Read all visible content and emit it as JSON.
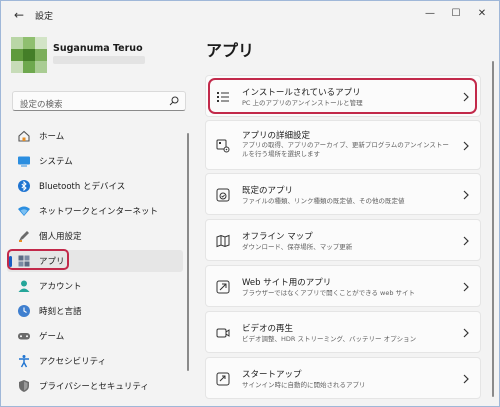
{
  "window": {
    "title": "設定",
    "back_icon": "back-arrow-icon"
  },
  "user": {
    "name": "Suganuma Teruo"
  },
  "search": {
    "placeholder": "設定の検索"
  },
  "sidebar": {
    "items": [
      {
        "label": "ホーム",
        "icon": "home-icon"
      },
      {
        "label": "システム",
        "icon": "system-icon"
      },
      {
        "label": "Bluetooth とデバイス",
        "icon": "bluetooth-icon"
      },
      {
        "label": "ネットワークとインターネット",
        "icon": "network-icon"
      },
      {
        "label": "個人用設定",
        "icon": "personalization-icon"
      },
      {
        "label": "アプリ",
        "icon": "apps-icon",
        "active": true
      },
      {
        "label": "アカウント",
        "icon": "account-icon"
      },
      {
        "label": "時刻と言語",
        "icon": "time-language-icon"
      },
      {
        "label": "ゲーム",
        "icon": "gaming-icon"
      },
      {
        "label": "アクセシビリティ",
        "icon": "accessibility-icon"
      },
      {
        "label": "プライバシーとセキュリティ",
        "icon": "privacy-icon"
      }
    ]
  },
  "main": {
    "title": "アプリ",
    "cards": [
      {
        "title": "インストールされているアプリ",
        "desc": "PC 上のアプリのアンインストールと管理",
        "icon": "installed-apps-icon"
      },
      {
        "title": "アプリの詳細設定",
        "desc": "アプリの取得、アプリのアーカイブ、更新プログラムのアンインストールを行う場所を選択します",
        "icon": "advanced-settings-icon"
      },
      {
        "title": "既定のアプリ",
        "desc": "ファイルの種類、リンク種類の既定値、その他の既定値",
        "icon": "default-apps-icon"
      },
      {
        "title": "オフライン マップ",
        "desc": "ダウンロード、保存場所、マップ更新",
        "icon": "offline-maps-icon"
      },
      {
        "title": "Web サイト用のアプリ",
        "desc": "ブラウザーではなくアプリで開くことができる web サイト",
        "icon": "web-apps-icon"
      },
      {
        "title": "ビデオの再生",
        "desc": "ビデオ調整、HDR ストリーミング、バッテリー オプション",
        "icon": "video-playback-icon"
      },
      {
        "title": "スタートアップ",
        "desc": "サインイン時に自動的に開始されるアプリ",
        "icon": "startup-icon"
      }
    ]
  },
  "colors": {
    "accent": "#1b5fc4",
    "highlight": "#c2294a",
    "background": "#f3f3f3",
    "card": "#fbfbfb"
  }
}
